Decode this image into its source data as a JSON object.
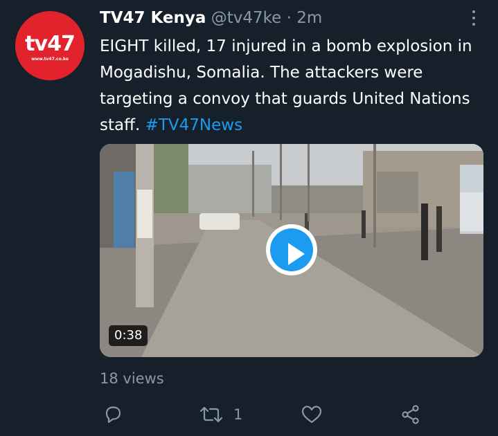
{
  "account": {
    "display_name": "TV47 Kenya",
    "handle": "@tv47ke",
    "separator": "·",
    "time": "2m",
    "avatar_logo_text": "tv47",
    "avatar_site_text": "www.tv47.co.ke",
    "avatar_color": "#e2232c"
  },
  "tweet": {
    "text": "EIGHT killed, 17 injured in a bomb explosion in Mogadishu, Somalia. The attackers were targeting a convoy that guards United Nations staff.",
    "hashtag": "#TV47News"
  },
  "media": {
    "type": "video",
    "duration": "0:38",
    "play_icon": "play-icon"
  },
  "stats": {
    "views": "18 views"
  },
  "actions": {
    "reply_icon": "reply-icon",
    "retweet_icon": "retweet-icon",
    "retweet_count": "1",
    "like_icon": "heart-icon",
    "share_icon": "share-icon"
  },
  "colors": {
    "background": "#15202b",
    "text": "#ffffff",
    "secondary": "#8b98a5",
    "accent": "#1d9bf0"
  }
}
